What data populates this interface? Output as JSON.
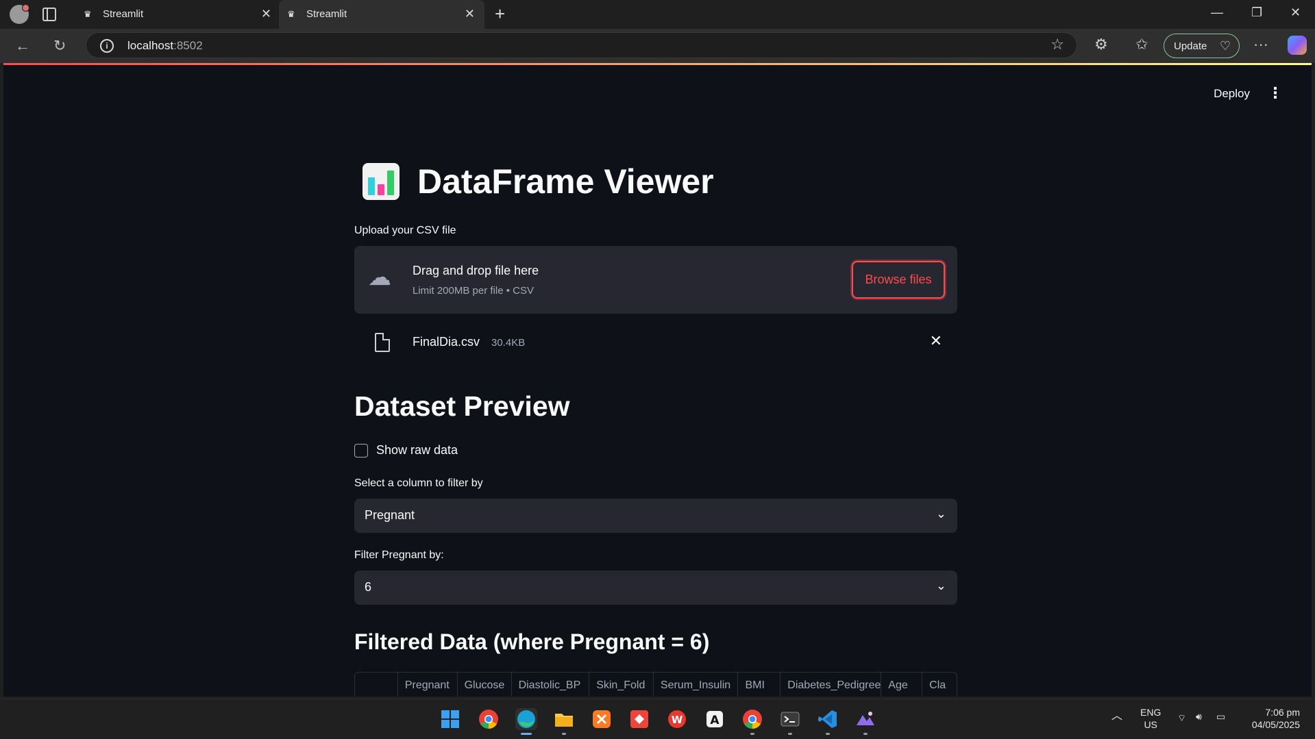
{
  "browser": {
    "tabs": [
      {
        "label": "Streamlit",
        "active": false
      },
      {
        "label": "Streamlit",
        "active": true
      }
    ],
    "url_host": "localhost",
    "url_port": ":8502",
    "update_label": "Update"
  },
  "app": {
    "toolbar": {
      "deploy_label": "Deploy"
    },
    "title": "DataFrame Viewer",
    "uploader": {
      "label": "Upload your CSV file",
      "drop_title": "Drag and drop file here",
      "drop_sub": "Limit 200MB per file • CSV",
      "browse_label": "Browse files"
    },
    "uploaded_file": {
      "name": "FinalDia.csv",
      "size": "30.4KB"
    },
    "preview_heading": "Dataset Preview",
    "show_raw": {
      "label": "Show raw data",
      "checked": false
    },
    "column_select": {
      "label": "Select a column to filter by",
      "value": "Pregnant"
    },
    "value_select": {
      "label": "Filter Pregnant by:",
      "value": "6"
    },
    "filtered_heading": "Filtered Data (where Pregnant = 6)",
    "table": {
      "columns": [
        "",
        "Pregnant",
        "Glucose",
        "Diastolic_BP",
        "Skin_Fold",
        "Serum_Insulin",
        "BMI",
        "Diabetes_Pedigree",
        "Age",
        "Cla"
      ]
    }
  },
  "taskbar": {
    "lang": "ENG",
    "region": "US",
    "time": "7:06 pm",
    "date": "04/05/2025"
  },
  "colors": {
    "accent": "#ff4b4b",
    "app_bg": "#0e1117",
    "widget_bg": "#262730",
    "muted_text": "#a3a8b8"
  }
}
